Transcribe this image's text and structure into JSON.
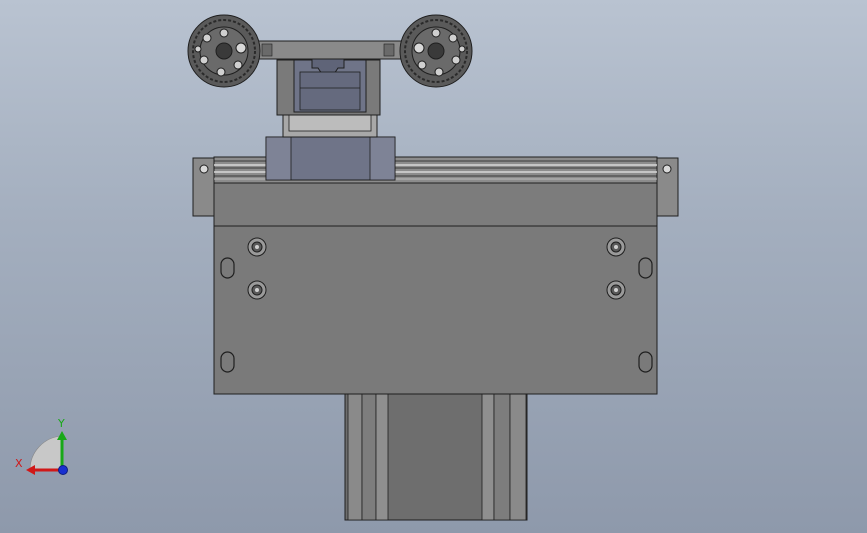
{
  "viewport": {
    "background_top": "#b9c3d1",
    "background_bottom": "#8e99ab"
  },
  "model": {
    "part_colors": {
      "plate": "#7a7a7a",
      "rail": "#8c8c8c",
      "carriage": "#6f7488",
      "motor": "#6e6e6e",
      "wheel": "#5a5a5a",
      "edge": "#1f1f1f"
    }
  },
  "triad": {
    "x_label": "X",
    "y_label": "Y",
    "x_color": "#d01818",
    "y_color": "#18a818",
    "z_color": "#1830d0"
  }
}
